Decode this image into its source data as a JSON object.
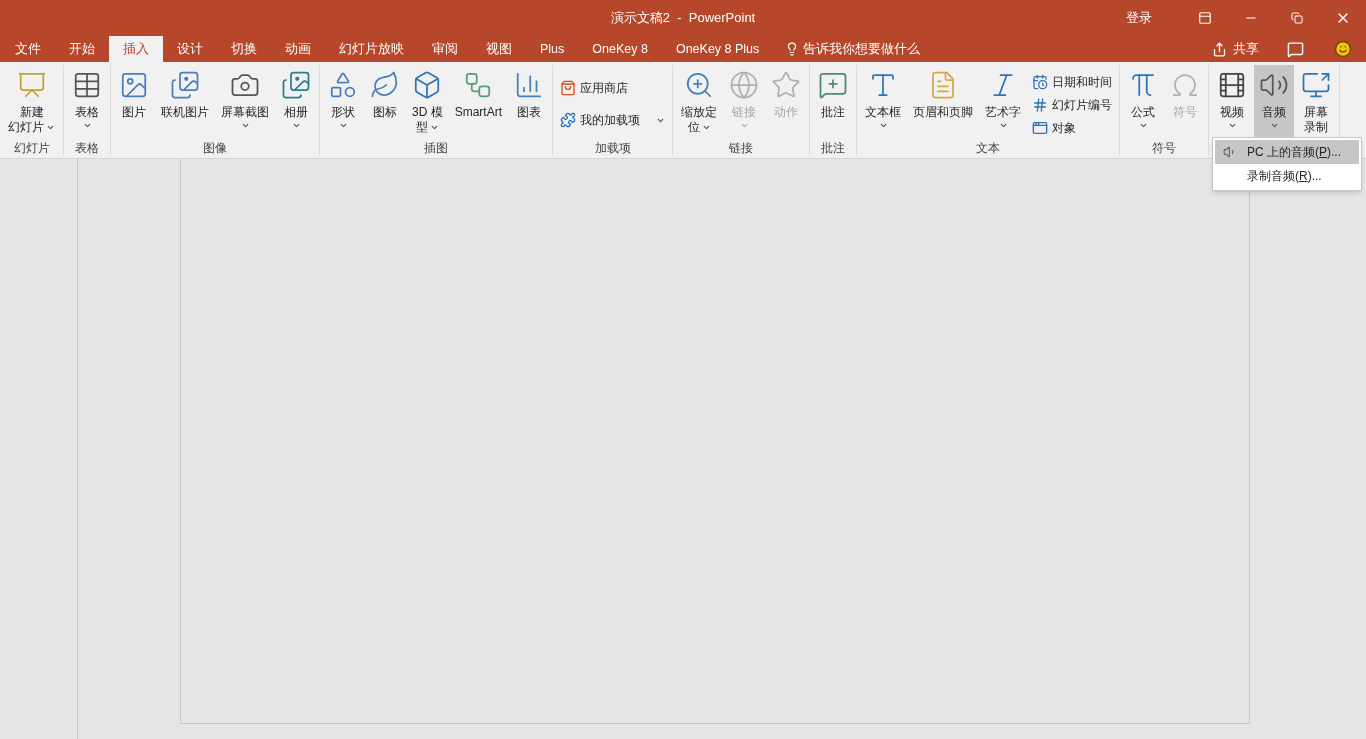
{
  "window": {
    "title": "演示文稿2  -  PowerPoint",
    "sign_in": "登录"
  },
  "tabs": [
    {
      "label": "文件",
      "selected": false
    },
    {
      "label": "开始",
      "selected": false
    },
    {
      "label": "插入",
      "selected": true
    },
    {
      "label": "设计",
      "selected": false
    },
    {
      "label": "切换",
      "selected": false
    },
    {
      "label": "动画",
      "selected": false
    },
    {
      "label": "幻灯片放映",
      "selected": false
    },
    {
      "label": "审阅",
      "selected": false
    },
    {
      "label": "视图",
      "selected": false
    },
    {
      "label": "Plus",
      "selected": false
    },
    {
      "label": "OneKey 8",
      "selected": false
    },
    {
      "label": "OneKey 8 Plus",
      "selected": false
    }
  ],
  "tell_me": "告诉我你想要做什么",
  "share": "共享",
  "ribbon": [
    {
      "label": "幻灯片",
      "items": [
        {
          "kind": "large",
          "lines": [
            "新建",
            "幻灯片"
          ],
          "dropdown": true
        }
      ]
    },
    {
      "label": "表格",
      "items": [
        {
          "kind": "large",
          "lines": [
            "表格"
          ],
          "dropdown": true
        }
      ]
    },
    {
      "label": "图像",
      "items": [
        {
          "kind": "large",
          "lines": [
            "图片"
          ],
          "dropdown": false
        },
        {
          "kind": "large",
          "lines": [
            "联机图片"
          ],
          "dropdown": false
        },
        {
          "kind": "large",
          "lines": [
            "屏幕截图"
          ],
          "dropdown": true
        },
        {
          "kind": "large",
          "lines": [
            "相册"
          ],
          "dropdown": true
        }
      ]
    },
    {
      "label": "插图",
      "items": [
        {
          "kind": "large",
          "lines": [
            "形状"
          ],
          "dropdown": true
        },
        {
          "kind": "large",
          "lines": [
            "图标"
          ],
          "dropdown": false
        },
        {
          "kind": "large",
          "lines": [
            "3D 模",
            "型"
          ],
          "dropdown": true
        },
        {
          "kind": "large",
          "lines": [
            "SmartArt"
          ],
          "dropdown": false
        },
        {
          "kind": "large",
          "lines": [
            "图表"
          ],
          "dropdown": false
        }
      ]
    },
    {
      "label": "加载项",
      "items": [
        {
          "kind": "stack",
          "children": [
            {
              "label": "应用商店",
              "dropdown": false
            },
            {
              "label": "我的加载项",
              "dropdown": true
            }
          ]
        }
      ]
    },
    {
      "label": "链接",
      "items": [
        {
          "kind": "large",
          "lines": [
            "缩放定",
            "位"
          ],
          "dropdown": true,
          "disabled": false
        },
        {
          "kind": "large",
          "lines": [
            "链接"
          ],
          "dropdown": true,
          "disabled": true
        },
        {
          "kind": "large",
          "lines": [
            "动作"
          ],
          "dropdown": false,
          "disabled": true
        }
      ]
    },
    {
      "label": "批注",
      "items": [
        {
          "kind": "large",
          "lines": [
            "批注"
          ],
          "dropdown": false
        }
      ]
    },
    {
      "label": "文本",
      "items": [
        {
          "kind": "large",
          "lines": [
            "文本框"
          ],
          "dropdown": true
        },
        {
          "kind": "large",
          "lines": [
            "页眉和页脚"
          ],
          "dropdown": false
        },
        {
          "kind": "large",
          "lines": [
            "艺术字"
          ],
          "dropdown": true
        },
        {
          "kind": "stack",
          "children": [
            {
              "label": "日期和时间",
              "dropdown": false
            },
            {
              "label": "幻灯片编号",
              "dropdown": false
            },
            {
              "label": "对象",
              "dropdown": false
            }
          ]
        }
      ]
    },
    {
      "label": "符号",
      "items": [
        {
          "kind": "large",
          "lines": [
            "公式"
          ],
          "dropdown": true,
          "disabled": false
        },
        {
          "kind": "large",
          "lines": [
            "符号"
          ],
          "dropdown": false,
          "disabled": true
        }
      ]
    },
    {
      "items": [
        {
          "kind": "large",
          "lines": [
            "视频"
          ],
          "dropdown": true,
          "pressed": false
        },
        {
          "kind": "large",
          "lines": [
            "音频"
          ],
          "dropdown": true,
          "pressed": true
        },
        {
          "kind": "large",
          "lines": [
            "屏幕",
            "录制"
          ],
          "dropdown": false,
          "pressed": false
        }
      ]
    }
  ],
  "audio_menu": [
    {
      "before": "PC 上的音频(",
      "accelerator": "P",
      "after": ")...",
      "selected": true
    },
    {
      "before": "录制音频(",
      "accelerator": "R",
      "after": ")...",
      "selected": false
    }
  ]
}
